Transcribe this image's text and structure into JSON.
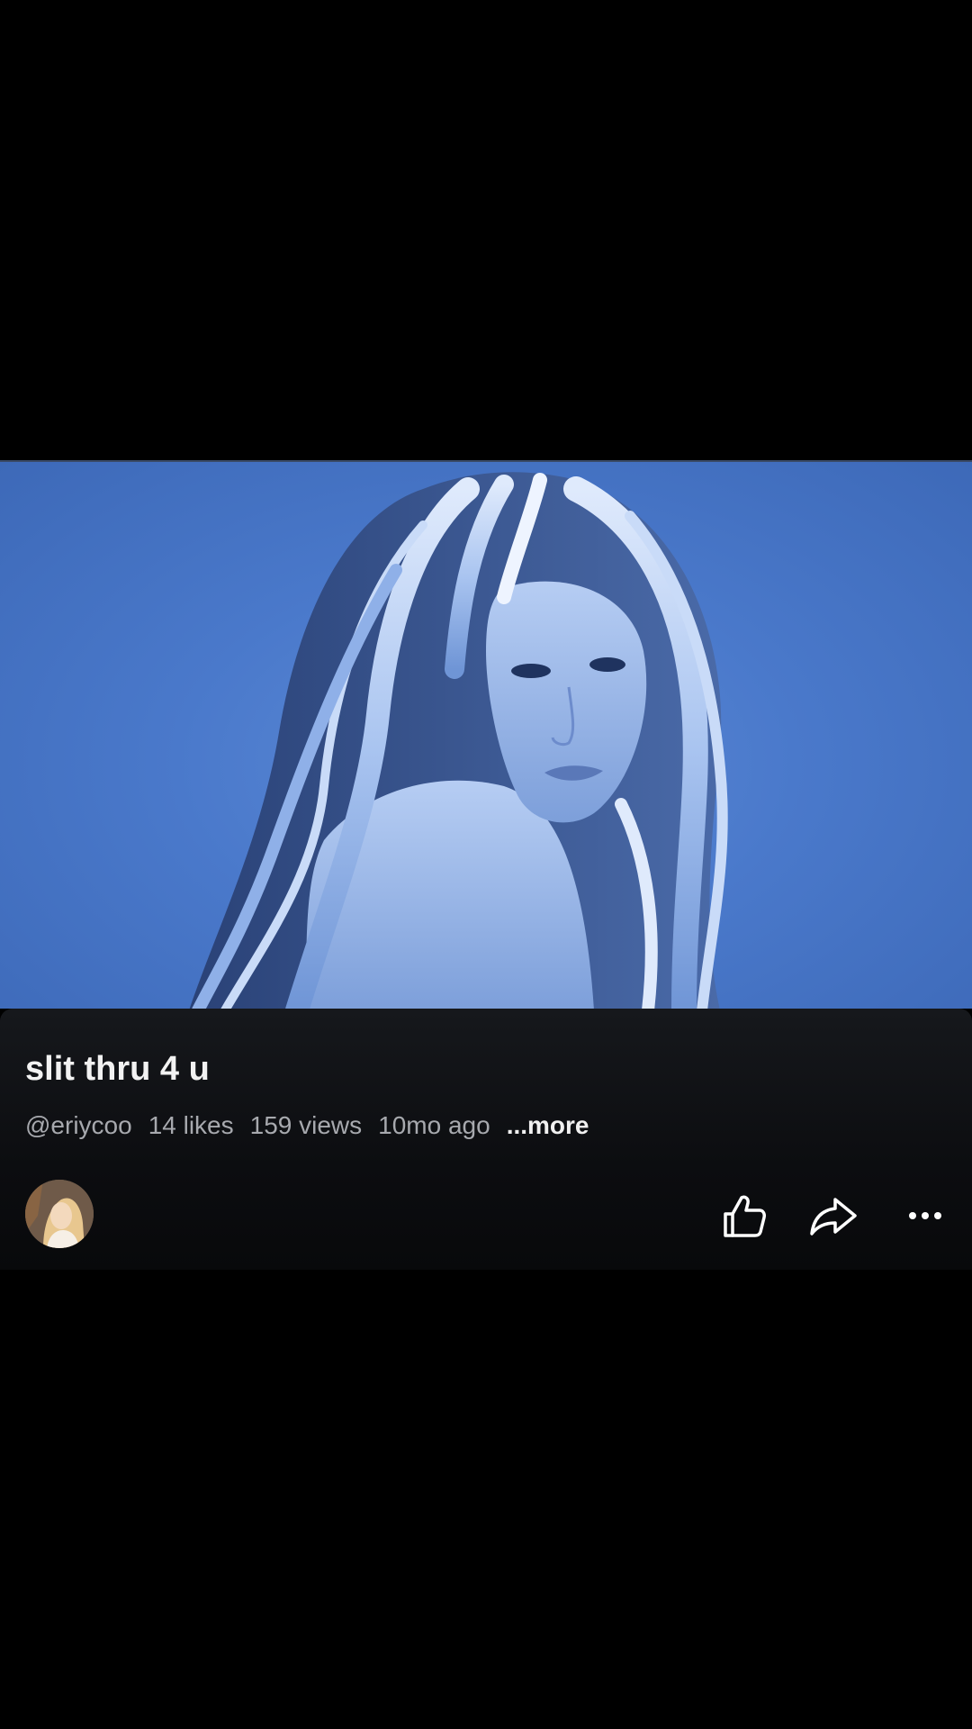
{
  "video": {
    "description_icon": "portrait-thumbnail"
  },
  "post": {
    "title": "slit thru 4 u",
    "username": "@eriycoo",
    "likes": "14 likes",
    "views": "159 views",
    "age": "10mo ago",
    "more_label": "...more"
  },
  "actions": {
    "like_icon": "thumbs-up-icon",
    "share_icon": "share-arrow-icon",
    "more_icon": "more-horizontal-icon"
  },
  "colors": {
    "background": "#000000",
    "video_blue": "#4a79cb",
    "panel": "#0c0d10",
    "title_text": "#f2f2f2",
    "meta_text": "#a7a9ae"
  }
}
